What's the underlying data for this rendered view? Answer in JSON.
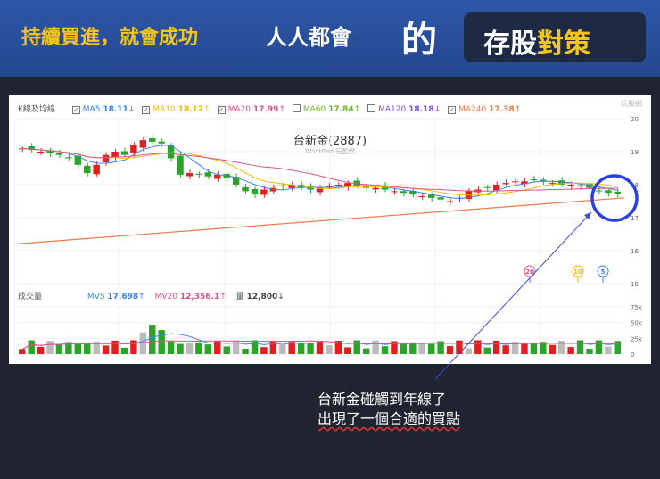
{
  "banner": {
    "slogan": "持續買進，就會成功",
    "everyone": "人人都會",
    "de": "的",
    "strategy_a": "存股",
    "strategy_b": "對策"
  },
  "legend": {
    "title": "K線及均線",
    "items": [
      {
        "label": "MA5",
        "value": "18.11",
        "arrow": "↓",
        "checked": true,
        "color": "#3b82f6"
      },
      {
        "label": "MA10",
        "value": "18.12",
        "arrow": "↑",
        "checked": true,
        "color": "#f5b800"
      },
      {
        "label": "MA20",
        "value": "17.99",
        "arrow": "↑",
        "checked": true,
        "color": "#e0508a"
      },
      {
        "label": "MA60",
        "value": "17.84",
        "arrow": "↑",
        "checked": false,
        "color": "#6cb82c"
      },
      {
        "label": "MA120",
        "value": "18.18",
        "arrow": "↓",
        "checked": false,
        "color": "#7b4fe0"
      },
      {
        "label": "MA240",
        "value": "17.38",
        "arrow": "↑",
        "checked": true,
        "color": "#f07a4a"
      }
    ]
  },
  "watermark": "玩股網",
  "chart_title": "台新金(2887)",
  "chart_subtitle": "WantGoo 玩股網",
  "price_ticks": [
    "20",
    "19",
    "18",
    "17",
    "16",
    "15"
  ],
  "vol_legend": {
    "title": "成交量",
    "mv5": "MV5",
    "mv5_val": "17,698",
    "mv5_arrow": "↑",
    "mv20": "MV20",
    "mv20_val": "12,356.1",
    "mv20_arrow": "↑",
    "vol": "量",
    "vol_val": "12,800",
    "vol_arrow": "↓"
  },
  "vol_ticks": [
    "75k",
    "50k",
    "25k",
    "0"
  ],
  "ma_markers": [
    "20",
    "10",
    "5"
  ],
  "note": [
    "台新金碰觸到年線了",
    "出現了一個合適的買點"
  ],
  "chart_data": {
    "type": "candlestick",
    "price_range": [
      15,
      20
    ],
    "closes": [
      19.1,
      19.05,
      19.0,
      18.95,
      18.9,
      18.8,
      18.6,
      18.35,
      18.6,
      18.9,
      19.0,
      18.9,
      19.2,
      19.35,
      19.3,
      19.25,
      18.8,
      18.3,
      18.35,
      18.3,
      18.25,
      18.3,
      18.2,
      18.0,
      17.8,
      17.7,
      17.85,
      17.9,
      17.95,
      18.0,
      17.9,
      17.85,
      17.9,
      17.95,
      18.0,
      18.05,
      17.95,
      17.9,
      17.9,
      17.85,
      17.8,
      17.75,
      17.7,
      17.65,
      17.6,
      17.55,
      17.5,
      17.6,
      17.8,
      17.85,
      17.9,
      18.0,
      18.05,
      18.1,
      18.1,
      18.15,
      18.1,
      18.05,
      18.0,
      18.0,
      17.95,
      17.9,
      17.8,
      17.75,
      17.7
    ],
    "ma240": [
      16.2,
      17.6
    ],
    "volume_range": [
      0,
      75000
    ]
  }
}
